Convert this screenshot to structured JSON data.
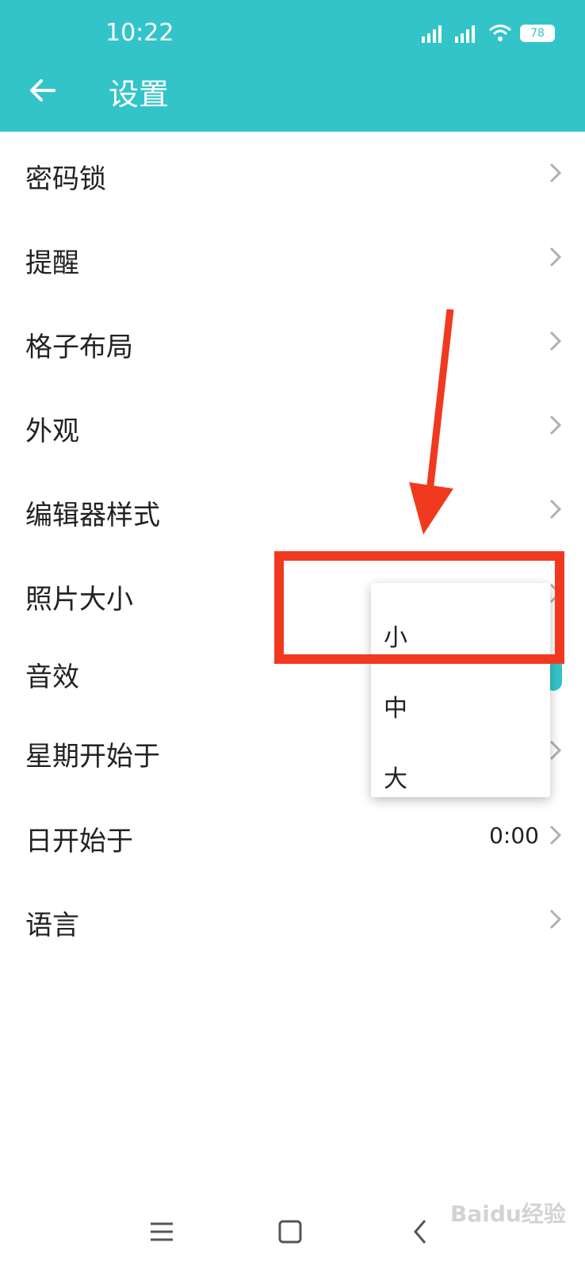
{
  "status_bar": {
    "time": "10:22",
    "battery": "78"
  },
  "header": {
    "title": "设置"
  },
  "settings": [
    {
      "label": "密码锁",
      "value": ""
    },
    {
      "label": "提醒",
      "value": ""
    },
    {
      "label": "格子布局",
      "value": ""
    },
    {
      "label": "外观",
      "value": ""
    },
    {
      "label": "编辑器样式",
      "value": ""
    },
    {
      "label": "照片大小",
      "value": ""
    },
    {
      "label": "音效",
      "value": ""
    },
    {
      "label": "星期开始于",
      "value": ""
    },
    {
      "label": "日开始于",
      "value": "0:00"
    },
    {
      "label": "语言",
      "value": ""
    }
  ],
  "dropdown": {
    "options": [
      "小",
      "中",
      "大"
    ]
  },
  "watermark": "Baidu经验",
  "colors": {
    "accent": "#33c4c9",
    "highlight": "#f1391f"
  }
}
